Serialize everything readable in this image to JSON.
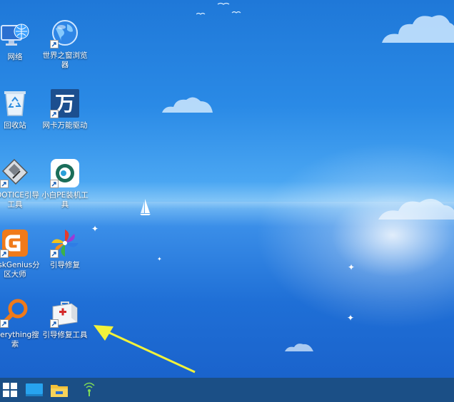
{
  "desktop": {
    "icons": [
      {
        "name": "network",
        "label": "网络"
      },
      {
        "name": "world-browser",
        "label": "世界之窗浏览器"
      },
      {
        "name": "recycle-bin",
        "label": "回收站"
      },
      {
        "name": "wan-driver",
        "label": "网卡万能驱动"
      },
      {
        "name": "bootice",
        "label": "BOOTICE引导工具"
      },
      {
        "name": "xiaobai-pe",
        "label": "小白PE装机工具"
      },
      {
        "name": "diskgenius",
        "label": "DiskGenius分区大师"
      },
      {
        "name": "boot-repair",
        "label": "引导修复"
      },
      {
        "name": "everything",
        "label": "Everything搜索"
      },
      {
        "name": "boot-repair-tool",
        "label": "引导修复工具"
      }
    ],
    "annotation_color": "#f2f23a"
  },
  "taskbar": {
    "buttons": [
      "windows-start-icon",
      "desktop-icon",
      "file-explorer-icon",
      "network-tray-icon"
    ],
    "color": "#1b4f86"
  },
  "icon_names": {
    "wan_char": "万"
  }
}
